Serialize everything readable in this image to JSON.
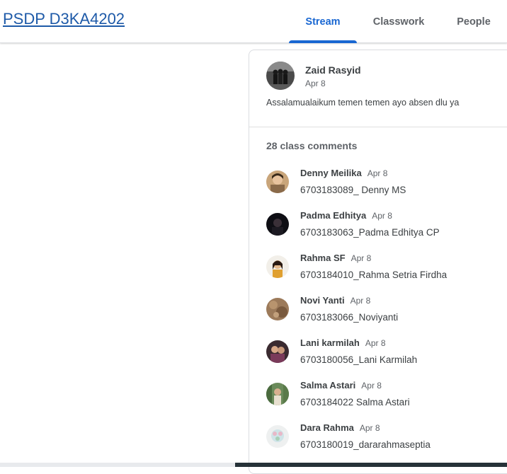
{
  "header": {
    "class_title": "PSDP D3KA4202",
    "tabs": [
      {
        "label": "Stream",
        "active": true
      },
      {
        "label": "Classwork",
        "active": false
      },
      {
        "label": "People",
        "active": false
      }
    ],
    "accent_color": "#1967d2"
  },
  "post": {
    "author": "Zaid Rasyid",
    "date": "Apr 8",
    "body": "Assalamualaikum temen temen ayo absen dlu ya",
    "comments_count_label": "28 class comments",
    "comments": [
      {
        "name": "Denny Meilika",
        "date": "Apr 8",
        "text": "6703183089_ Denny MS"
      },
      {
        "name": "Padma Edhitya",
        "date": "Apr 8",
        "text": "6703183063_Padma Edhitya CP"
      },
      {
        "name": "Rahma SF",
        "date": "Apr 8",
        "text": "6703184010_Rahma Setria Firdha"
      },
      {
        "name": "Novi Yanti",
        "date": "Apr 8",
        "text": "6703183066_Noviyanti"
      },
      {
        "name": "Lani karmilah",
        "date": "Apr 8",
        "text": "6703180056_Lani Karmilah"
      },
      {
        "name": "Salma Astari",
        "date": "Apr 8",
        "text": "6703184022 Salma Astari"
      },
      {
        "name": "Dara Rahma",
        "date": "Apr 8",
        "text": "6703180019_dararahmaseptia"
      }
    ]
  }
}
